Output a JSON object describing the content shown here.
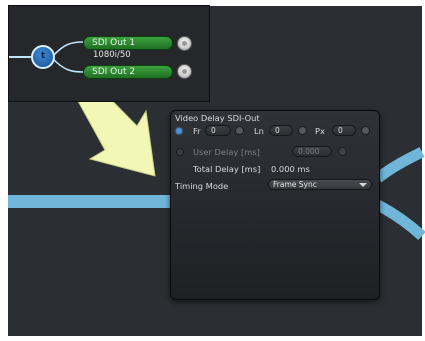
{
  "inset": {
    "node": {
      "label": "t"
    },
    "outputs": [
      {
        "label": "SDI Out 1",
        "sublabel": "1080i/50"
      },
      {
        "label": "SDI Out 2"
      }
    ]
  },
  "panel": {
    "title": "Video Delay SDI-Out",
    "delay": {
      "fr_label": "Fr",
      "fr_value": "0",
      "ln_label": "Ln",
      "ln_value": "0",
      "px_label": "Px",
      "px_value": "0"
    },
    "user_delay": {
      "label": "User Delay [ms]",
      "value": "0.000"
    },
    "total_delay": {
      "label": "Total Delay [ms]",
      "value": "0.000 ms"
    },
    "timing_mode": {
      "label": "Timing Mode",
      "value": "Frame Sync"
    }
  },
  "colors": {
    "canvas_bg": "#2b2e33",
    "connection": "#6fb6d8",
    "arrow": "#f2f7b6",
    "pill_green": "#2f8b33",
    "node_blue": "#2a6bb8"
  }
}
